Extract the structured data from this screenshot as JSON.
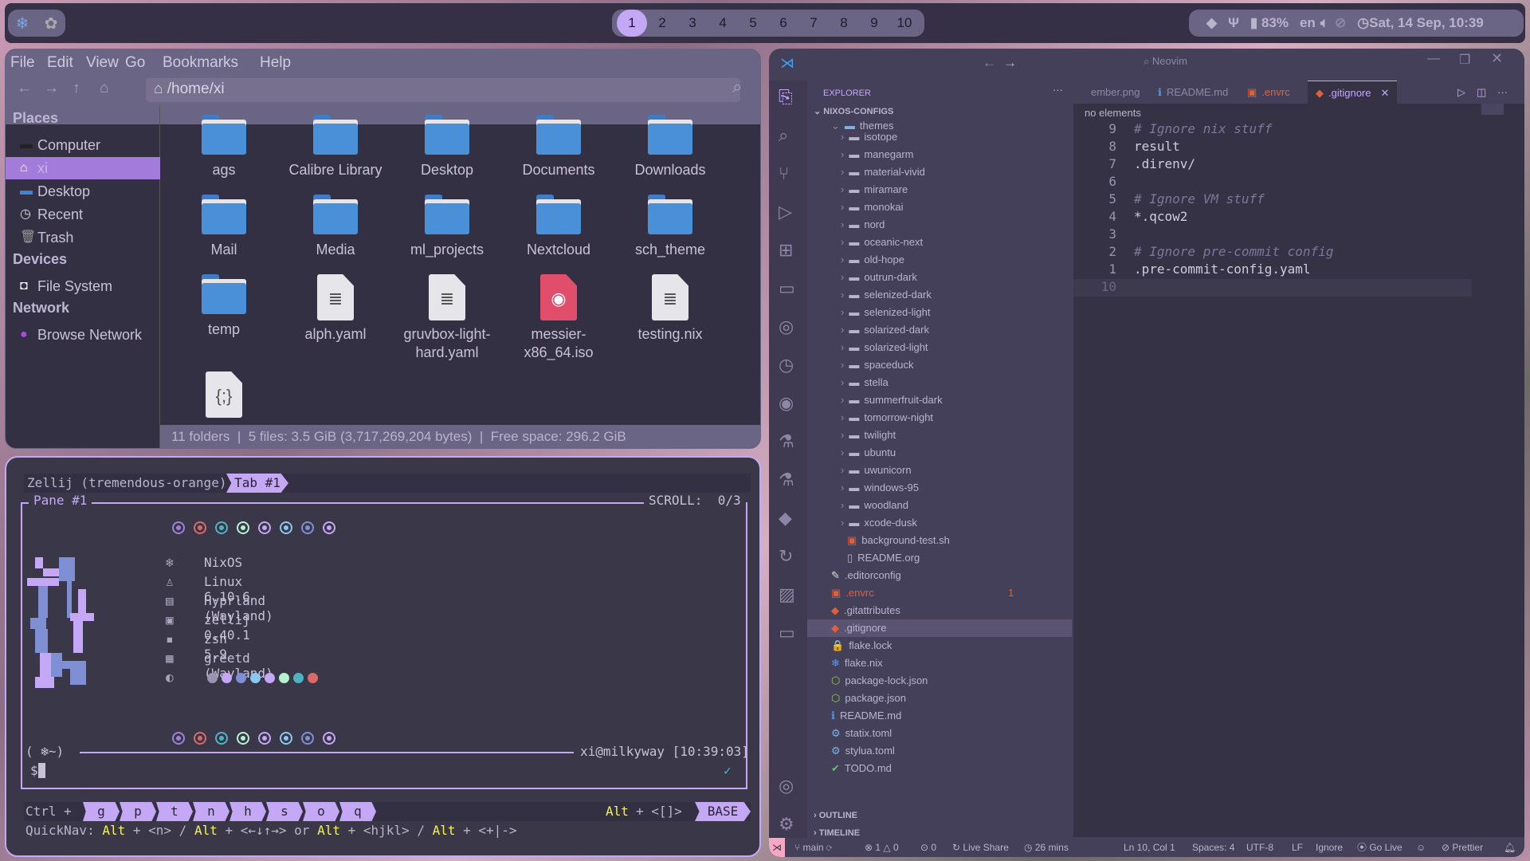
{
  "topbar": {
    "left_icons": [
      "nixos-icon",
      "openai-icon"
    ],
    "workspaces": [
      "1",
      "2",
      "3",
      "4",
      "5",
      "6",
      "7",
      "8",
      "9",
      "10"
    ],
    "active_workspace": "1",
    "battery": "83%",
    "language": "en",
    "datetime": "Sat, 14 Sep, 10:39"
  },
  "file_manager": {
    "menu": [
      "File",
      "Edit",
      "View",
      "Go",
      "Bookmarks",
      "Help"
    ],
    "path": "/home/xi",
    "sidebar": {
      "places_title": "Places",
      "places": [
        {
          "label": "Computer",
          "icon": "computer-icon"
        },
        {
          "label": "xi",
          "icon": "home-icon",
          "selected": true
        },
        {
          "label": "Desktop",
          "icon": "desktop-icon"
        },
        {
          "label": "Recent",
          "icon": "clock-icon"
        },
        {
          "label": "Trash",
          "icon": "trash-icon"
        }
      ],
      "devices_title": "Devices",
      "devices": [
        {
          "label": "File System",
          "icon": "drive-icon"
        }
      ],
      "network_title": "Network",
      "network": [
        {
          "label": "Browse Network",
          "icon": "globe-icon"
        }
      ]
    },
    "items": [
      {
        "name": "ags",
        "type": "folder"
      },
      {
        "name": "Calibre Library",
        "type": "folder"
      },
      {
        "name": "Desktop",
        "type": "folder"
      },
      {
        "name": "Documents",
        "type": "folder"
      },
      {
        "name": "Downloads",
        "type": "folder"
      },
      {
        "name": "Mail",
        "type": "folder"
      },
      {
        "name": "Media",
        "type": "folder"
      },
      {
        "name": "ml_projects",
        "type": "folder"
      },
      {
        "name": "Nextcloud",
        "type": "folder"
      },
      {
        "name": "sch_theme",
        "type": "folder"
      },
      {
        "name": "temp",
        "type": "folder"
      },
      {
        "name": "alph.yaml",
        "type": "text"
      },
      {
        "name": "gruvbox-light-hard.yaml",
        "type": "text"
      },
      {
        "name": "messier-x86_64.iso",
        "type": "iso"
      },
      {
        "name": "testing.nix",
        "type": "text"
      },
      {
        "name": "",
        "type": "json"
      }
    ],
    "status": "11 folders  |  5 files: 3.5 GiB (3,717,269,204 bytes)  |  Free space: 296.2 GiB"
  },
  "terminal": {
    "session": "Zellij (tremendous-orange)",
    "tab": "Tab #1",
    "pane": "Pane #1",
    "scroll": "SCROLL:  0/3",
    "ring_colors": [
      "#a07ed8",
      "#d96a6a",
      "#4fb3c4",
      "#b5f2d0",
      "#c4a7f5",
      "#8ac8f0",
      "#7f8fd4",
      "#c4a7f5"
    ],
    "info": [
      {
        "icon": "nixos-icon",
        "text": "NixOS"
      },
      {
        "icon": "linux-icon",
        "text": "Linux 6.10.6"
      },
      {
        "icon": "window-icon",
        "text": "Hyprland (Wayland)"
      },
      {
        "icon": "terminal-icon",
        "text": "zellij 0.40.1"
      },
      {
        "icon": "shell-icon",
        "text": "zsh 5.9"
      },
      {
        "icon": "monitor-icon",
        "text": "greetd (Wayland)"
      },
      {
        "icon": "palette-icon",
        "text": ""
      }
    ],
    "palette": [
      "#9a94b0",
      "#c4a7f5",
      "#7f8fd4",
      "#8ac8f0",
      "#c4a7f5",
      "#b5f2d0",
      "#4fb3c4",
      "#d96a6a"
    ],
    "prompt_dir": "( ❄~)",
    "prompt_user": "xi@milkyway [10:39:03]",
    "prompt": "$",
    "keybar_prefix": "Ctrl +",
    "keys": [
      "g",
      "p",
      "t",
      "n",
      "h",
      "s",
      "o",
      "q"
    ],
    "mode_hint_alt": "Alt",
    "mode_hint_rest": "+ <[]>",
    "mode": "BASE",
    "quicknav": [
      {
        "t": "QuickNav: ",
        "y": false
      },
      {
        "t": "Alt",
        "y": true
      },
      {
        "t": " + <n> / ",
        "y": false
      },
      {
        "t": "Alt",
        "y": true
      },
      {
        "t": " + <←↓↑→> or ",
        "y": false
      },
      {
        "t": "Alt",
        "y": true
      },
      {
        "t": " + <hjkl> / ",
        "y": false
      },
      {
        "t": "Alt",
        "y": true
      },
      {
        "t": " + <+|->",
        "y": false
      }
    ]
  },
  "vscode": {
    "search": "Neovim",
    "explorer_title": "EXPLORER",
    "root": "NIXOS-CONFIGS",
    "tabs": [
      {
        "label": "ember.png"
      },
      {
        "label": "README.md"
      },
      {
        "label": ".envrc",
        "badge": "1"
      },
      {
        "label": ".gitignore",
        "active": true
      }
    ],
    "tree": [
      {
        "label": "themes",
        "depth": 1,
        "kind": "open"
      },
      {
        "label": "isotope",
        "depth": 2,
        "kind": "dir"
      },
      {
        "label": "manegarm",
        "depth": 2,
        "kind": "dir"
      },
      {
        "label": "material-vivid",
        "depth": 2,
        "kind": "dir"
      },
      {
        "label": "miramare",
        "depth": 2,
        "kind": "dir"
      },
      {
        "label": "monokai",
        "depth": 2,
        "kind": "dir"
      },
      {
        "label": "nord",
        "depth": 2,
        "kind": "dir"
      },
      {
        "label": "oceanic-next",
        "depth": 2,
        "kind": "dir"
      },
      {
        "label": "old-hope",
        "depth": 2,
        "kind": "dir"
      },
      {
        "label": "outrun-dark",
        "depth": 2,
        "kind": "dir"
      },
      {
        "label": "selenized-dark",
        "depth": 2,
        "kind": "dir"
      },
      {
        "label": "selenized-light",
        "depth": 2,
        "kind": "dir"
      },
      {
        "label": "solarized-dark",
        "depth": 2,
        "kind": "dir"
      },
      {
        "label": "solarized-light",
        "depth": 2,
        "kind": "dir"
      },
      {
        "label": "spaceduck",
        "depth": 2,
        "kind": "dir"
      },
      {
        "label": "stella",
        "depth": 2,
        "kind": "dir"
      },
      {
        "label": "summerfruit-dark",
        "depth": 2,
        "kind": "dir"
      },
      {
        "label": "tomorrow-night",
        "depth": 2,
        "kind": "dir"
      },
      {
        "label": "twilight",
        "depth": 2,
        "kind": "dir"
      },
      {
        "label": "ubuntu",
        "depth": 2,
        "kind": "dir"
      },
      {
        "label": "uwunicorn",
        "depth": 2,
        "kind": "dir"
      },
      {
        "label": "windows-95",
        "depth": 2,
        "kind": "dir"
      },
      {
        "label": "woodland",
        "depth": 2,
        "kind": "dir"
      },
      {
        "label": "xcode-dusk",
        "depth": 2,
        "kind": "dir"
      },
      {
        "label": "background-test.sh",
        "depth": 3,
        "kind": "file",
        "icon": "▣",
        "color": "#e0603a"
      },
      {
        "label": "README.org",
        "depth": 3,
        "kind": "file",
        "icon": "▯",
        "color": "#b9b3cc"
      },
      {
        "label": ".editorconfig",
        "depth": 1,
        "kind": "file",
        "icon": "✎",
        "color": "#dddddd"
      },
      {
        "label": ".envrc",
        "depth": 1,
        "kind": "file",
        "icon": "▣",
        "color": "#e0603a",
        "badge": "1"
      },
      {
        "label": ".gitattributes",
        "depth": 1,
        "kind": "file",
        "icon": "◆",
        "color": "#e0603a"
      },
      {
        "label": ".gitignore",
        "depth": 1,
        "kind": "file",
        "icon": "◆",
        "color": "#e0603a",
        "selected": true
      },
      {
        "label": "flake.lock",
        "depth": 1,
        "kind": "file",
        "icon": "🔒",
        "color": "#f5c542"
      },
      {
        "label": "flake.nix",
        "depth": 1,
        "kind": "file",
        "icon": "❄",
        "color": "#5a9ae6"
      },
      {
        "label": "package-lock.json",
        "depth": 1,
        "kind": "file",
        "icon": "⬡",
        "color": "#8cc84b"
      },
      {
        "label": "package.json",
        "depth": 1,
        "kind": "file",
        "icon": "⬡",
        "color": "#8cc84b"
      },
      {
        "label": "README.md",
        "depth": 1,
        "kind": "file",
        "icon": "ℹ",
        "color": "#3fa0f0"
      },
      {
        "label": "statix.toml",
        "depth": 1,
        "kind": "file",
        "icon": "⚙",
        "color": "#7fb0e0"
      },
      {
        "label": "stylua.toml",
        "depth": 1,
        "kind": "file",
        "icon": "⚙",
        "color": "#7fb0e0"
      },
      {
        "label": "TODO.md",
        "depth": 1,
        "kind": "file",
        "icon": "✔",
        "color": "#5fc45f"
      }
    ],
    "outline": "OUTLINE",
    "timeline": "TIMELINE",
    "breadcrumb": "no elements",
    "lines": [
      {
        "n": "9",
        "t": "# Ignore nix stuff",
        "c": true
      },
      {
        "n": "8",
        "t": "result"
      },
      {
        "n": "7",
        "t": ".direnv/"
      },
      {
        "n": "6",
        "t": ""
      },
      {
        "n": "5",
        "t": "# Ignore VM stuff",
        "c": true
      },
      {
        "n": "4",
        "t": "*.qcow2"
      },
      {
        "n": "3",
        "t": ""
      },
      {
        "n": "2",
        "t": "# Ignore pre-commit config",
        "c": true
      },
      {
        "n": "1",
        "t": ".pre-commit-config.yaml"
      },
      {
        "n": "10",
        "t": "",
        "current": true
      }
    ],
    "status": {
      "branch": "main",
      "errors": "1",
      "warnings": "0",
      "ports": "0",
      "live_share": "Live Share",
      "time": "26 mins",
      "position": "Ln 10, Col 1",
      "spaces": "Spaces: 4",
      "encoding": "UTF-8",
      "eol": "LF",
      "language": "Ignore",
      "go_live": "Go Live",
      "prettier": "Prettier"
    },
    "accent": "#c4a7f5"
  }
}
